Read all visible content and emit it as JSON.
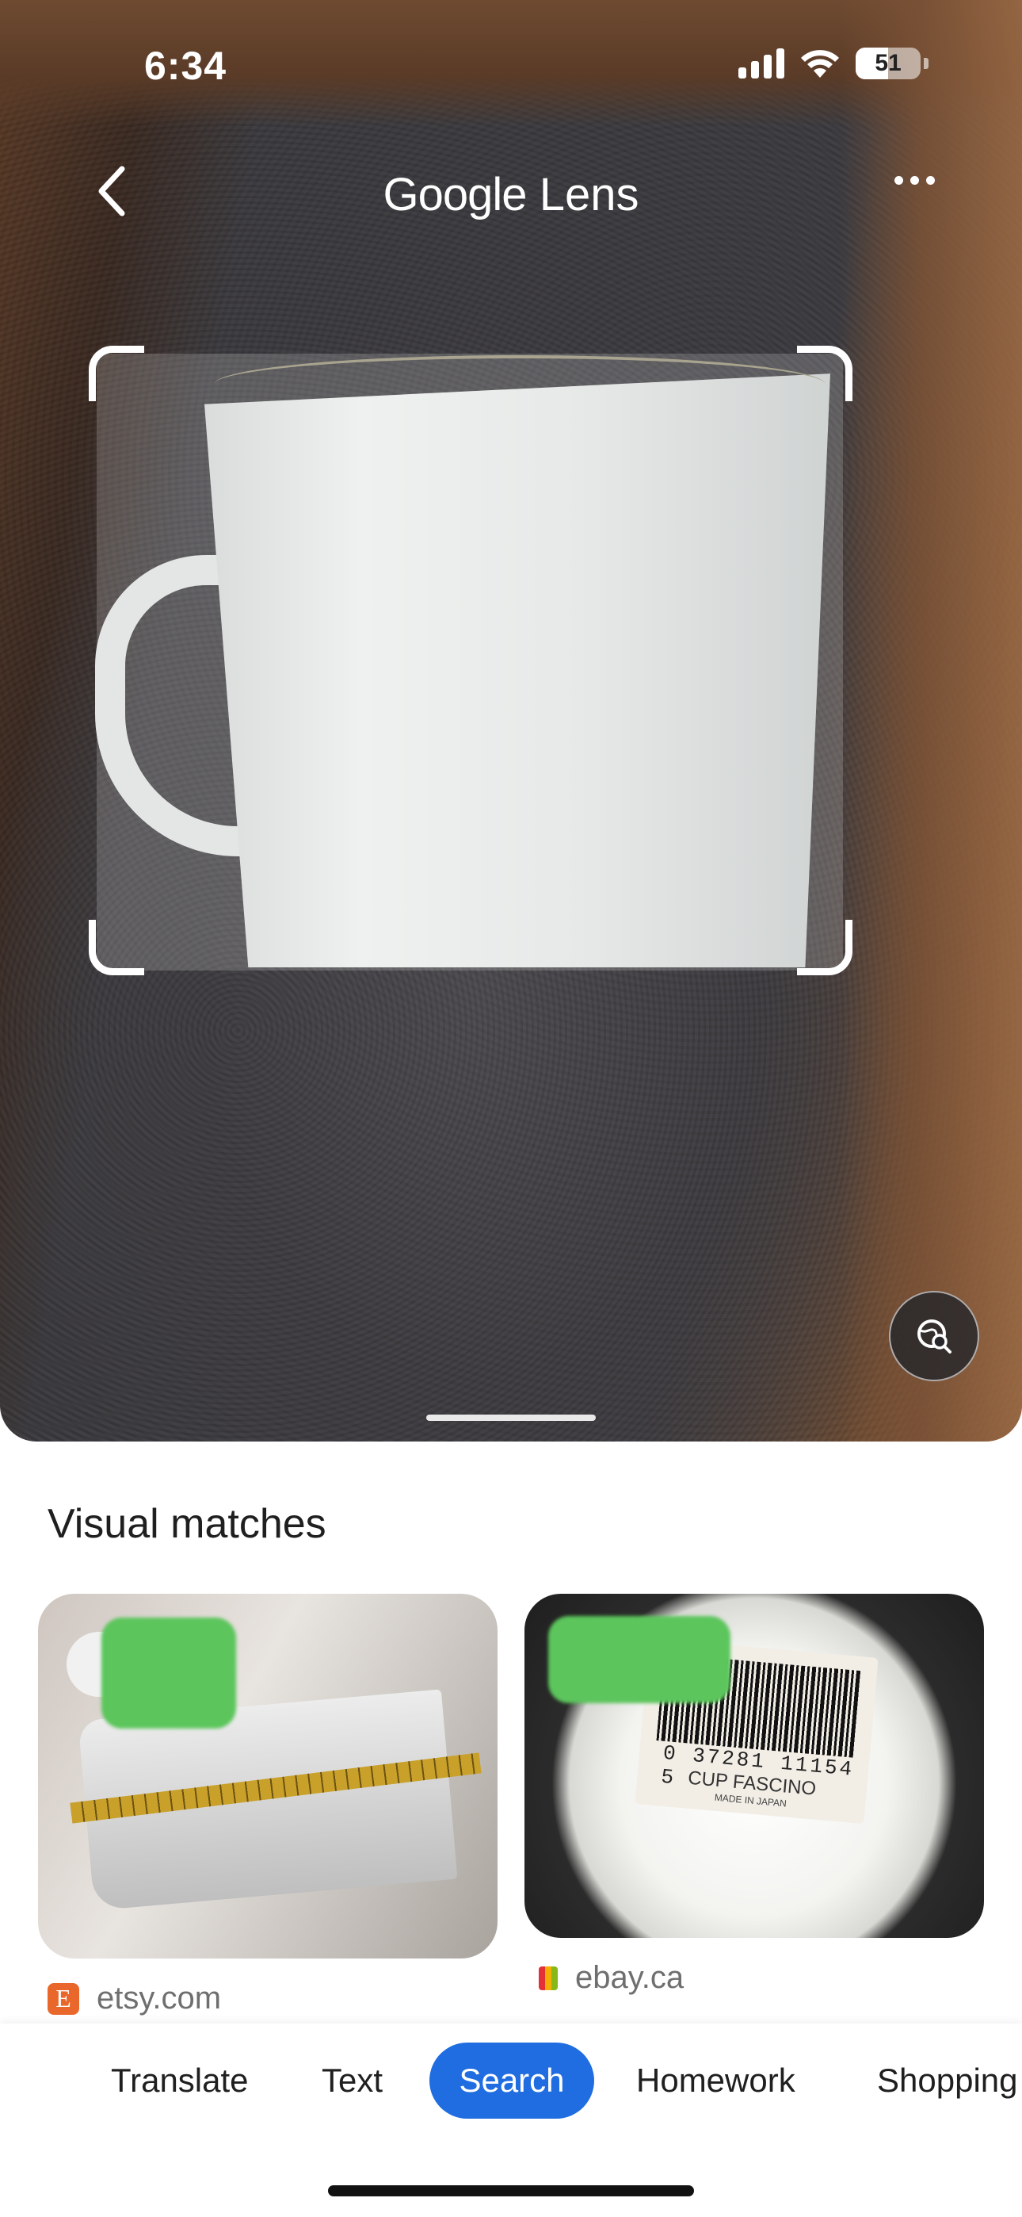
{
  "status_bar": {
    "time": "6:34",
    "battery": "51"
  },
  "header": {
    "title_brand": "Google",
    "title_product": "Lens"
  },
  "results": {
    "section_title": "Visual matches",
    "items": [
      {
        "source": "etsy.com"
      },
      {
        "source": "ebay.ca",
        "barcode_number": "0 37281 11154 5",
        "label_name": "CUP FASCINO",
        "label_origin": "MADE IN JAPAN"
      }
    ]
  },
  "tabs": [
    {
      "label": "Translate"
    },
    {
      "label": "Text"
    },
    {
      "label": "Search",
      "selected": true
    },
    {
      "label": "Homework"
    },
    {
      "label": "Shopping"
    }
  ],
  "colors": {
    "accent": "#1f6de0",
    "etsy": "#e9672b"
  }
}
